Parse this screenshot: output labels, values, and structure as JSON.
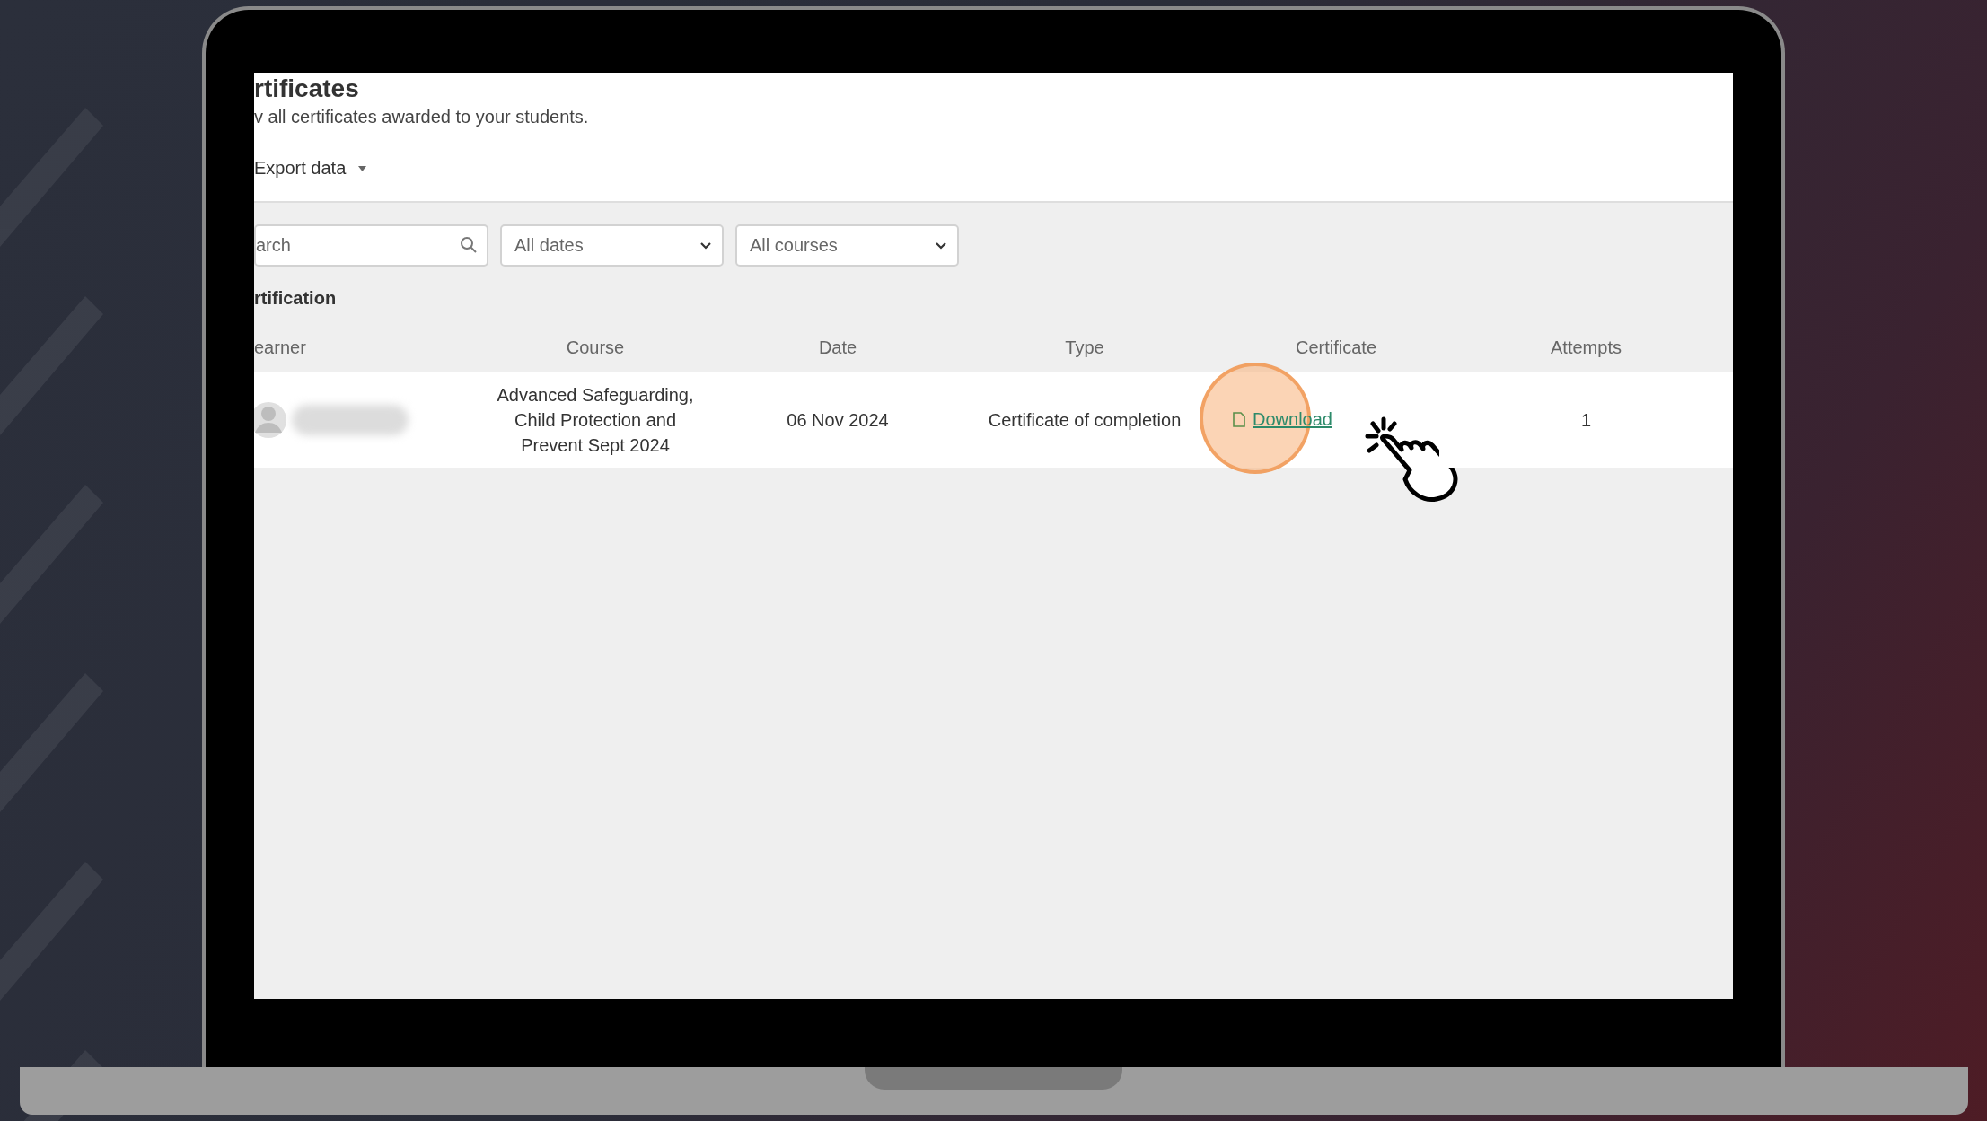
{
  "page": {
    "title": "rtificates",
    "subtitle": "v all certificates awarded to your students.",
    "export_button": {
      "label": "Export data"
    }
  },
  "filters": {
    "search": {
      "placeholder": "arch"
    },
    "selects": [
      {
        "value": "All dates"
      },
      {
        "value": "All courses"
      }
    ]
  },
  "section_title": "rtification",
  "table": {
    "columns": [
      "earner",
      "Course",
      "Date",
      "Type",
      "Certificate",
      "Attempts"
    ],
    "rows": [
      {
        "course": "Advanced Safeguarding, Child Protection and Prevent Sept 2024",
        "date": "06 Nov 2024",
        "type": "Certificate of completion",
        "certificate": "Download",
        "attempts": "1"
      }
    ]
  }
}
